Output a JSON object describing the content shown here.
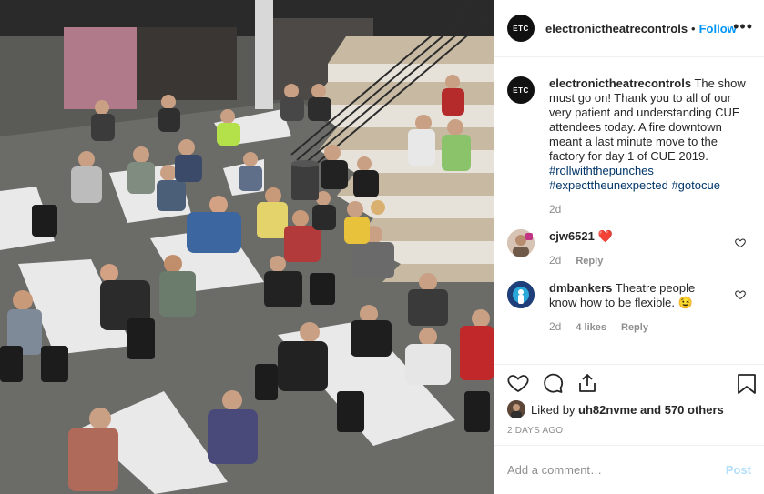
{
  "post": {
    "photo_alt": "",
    "author": "electronictheatrecontrols",
    "author_avatar_text": "ETC",
    "dot": "•",
    "follow_label": "Follow",
    "more_label": "•••",
    "caption": {
      "text": "The show must go on! Thank you to all of our very patient and understanding CUE attendees today. A fire downtown meant a last minute move to the factory for day 1 of CUE 2019.",
      "hashtags": [
        "#rollwiththepunches",
        "#expecttheunexpected",
        "#gotocue"
      ],
      "age": "2d"
    },
    "comments": [
      {
        "user": "cjw6521",
        "text": "❤️",
        "age": "2d",
        "likes": "",
        "reply_label": "Reply"
      },
      {
        "user": "dmbankers",
        "text": "Theatre people know how to be flexible. 😉",
        "age": "2d",
        "likes": "4 likes",
        "reply_label": "Reply"
      }
    ],
    "liked_by_user": "uh82nvme",
    "liked_by_rest": "and 570 others",
    "liked_by_prefix": "Liked by",
    "timestamp": "2 DAYS AGO",
    "add_comment_placeholder": "Add a comment…",
    "post_label": "Post"
  },
  "colors": {
    "link": "#0095f6",
    "hashtag": "#003569",
    "muted": "#8e8e8e",
    "heart": "#ed4956"
  }
}
